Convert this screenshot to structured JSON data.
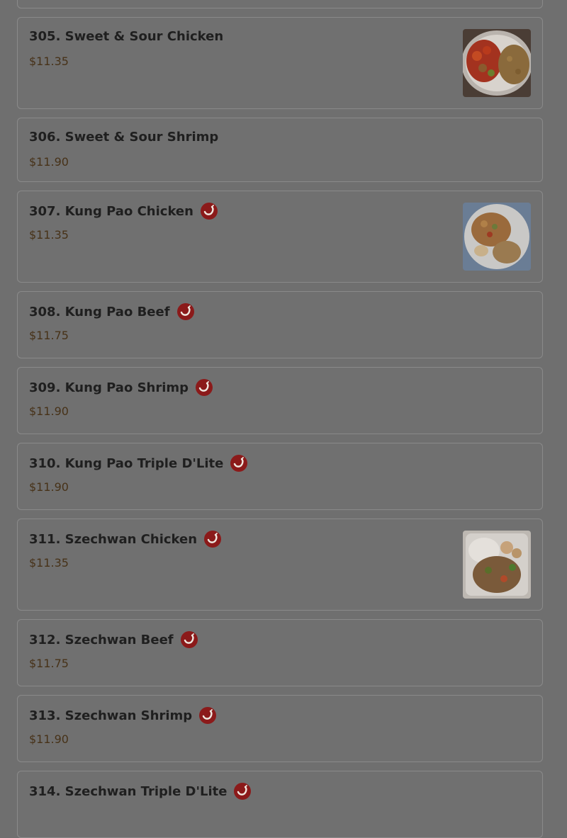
{
  "menu_items": [
    {
      "id": "item-304",
      "name": "",
      "price": "",
      "spicy": false,
      "has_image": false
    },
    {
      "id": "item-305",
      "name": "305. Sweet & Sour Chicken",
      "price": "$11.35",
      "spicy": false,
      "has_image": true,
      "image_icon": "sweet-sour-chicken-photo"
    },
    {
      "id": "item-306",
      "name": "306. Sweet & Sour Shrimp",
      "price": "$11.90",
      "spicy": false,
      "has_image": false
    },
    {
      "id": "item-307",
      "name": "307. Kung Pao Chicken",
      "price": "$11.35",
      "spicy": true,
      "spicy_icon": "chili-pepper-icon",
      "has_image": true,
      "image_icon": "kung-pao-chicken-photo"
    },
    {
      "id": "item-308",
      "name": "308. Kung Pao Beef",
      "price": "$11.75",
      "spicy": true,
      "spicy_icon": "chili-pepper-icon",
      "has_image": false
    },
    {
      "id": "item-309",
      "name": "309. Kung Pao Shrimp",
      "price": "$11.90",
      "spicy": true,
      "spicy_icon": "chili-pepper-icon",
      "has_image": false
    },
    {
      "id": "item-310",
      "name": "310. Kung Pao Triple D'Lite",
      "price": "$11.90",
      "spicy": true,
      "spicy_icon": "chili-pepper-icon",
      "has_image": false
    },
    {
      "id": "item-311",
      "name": "311. Szechwan Chicken",
      "price": "$11.35",
      "spicy": true,
      "spicy_icon": "chili-pepper-icon",
      "has_image": true,
      "image_icon": "szechwan-chicken-photo"
    },
    {
      "id": "item-312",
      "name": "312. Szechwan Beef",
      "price": "$11.75",
      "spicy": true,
      "spicy_icon": "chili-pepper-icon",
      "has_image": false
    },
    {
      "id": "item-313",
      "name": "313. Szechwan Shrimp",
      "price": "$11.90",
      "spicy": true,
      "spicy_icon": "chili-pepper-icon",
      "has_image": false
    },
    {
      "id": "item-314",
      "name": "314. Szechwan Triple D'Lite",
      "price": "",
      "spicy": true,
      "spicy_icon": "chili-pepper-icon",
      "has_image": false
    }
  ],
  "colors": {
    "overlay_bg": "#6f6f6f",
    "card_border": "#8a8a8a",
    "title_text": "#1f1f1f",
    "price_text": "#473218",
    "spicy_badge": "#8b1a1a"
  }
}
